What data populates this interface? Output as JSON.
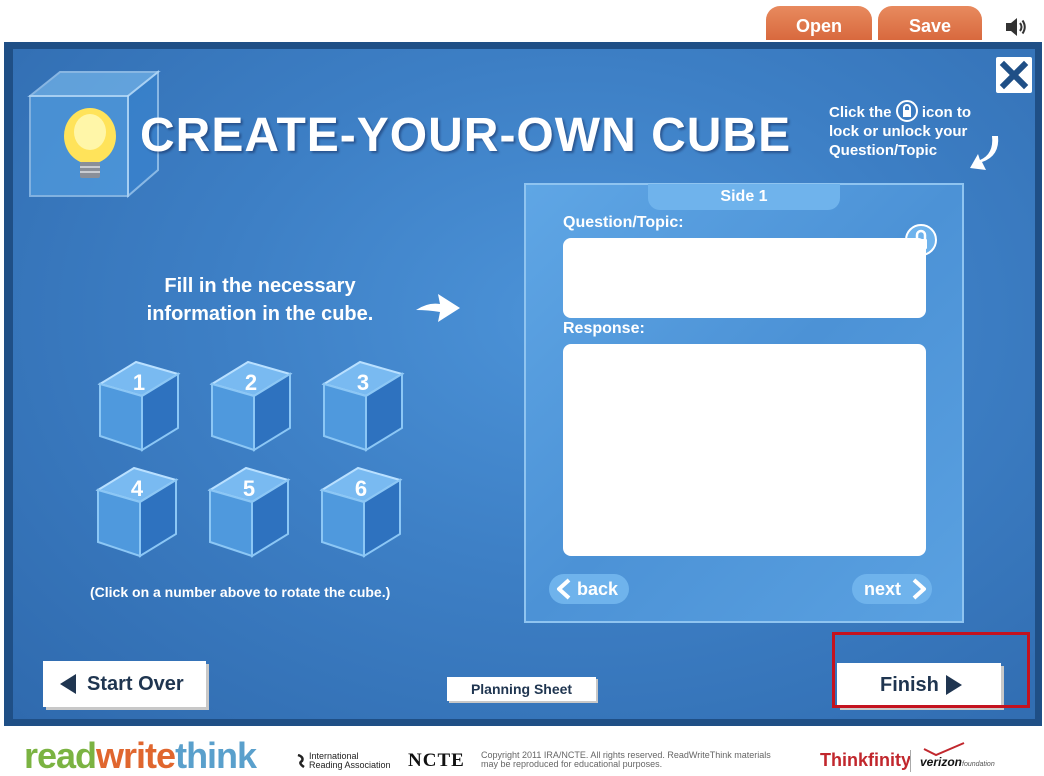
{
  "header": {
    "open_label": "Open",
    "save_label": "Save",
    "speaker_icon": "speaker-icon"
  },
  "main": {
    "title": "CREATE-YOUR-OWN CUBE",
    "lock_hint_before": "Click the",
    "lock_hint_after": "icon to lock or unlock your Question/Topic",
    "instructions": "Fill in the necessary information in the cube.",
    "cube_numbers": [
      "1",
      "2",
      "3",
      "4",
      "5",
      "6"
    ],
    "rotate_hint": "(Click on a number above to rotate the cube.)"
  },
  "editor": {
    "side_label": "Side 1",
    "question_label": "Question/Topic:",
    "question_value": "",
    "response_label": "Response:",
    "response_value": "",
    "back_label": "back",
    "next_label": "next"
  },
  "footer_buttons": {
    "start_over_label": "Start Over",
    "planning_sheet_label": "Planning Sheet",
    "finish_label": "Finish"
  },
  "footer": {
    "logo_read": "read",
    "logo_write": "write",
    "logo_think": "think",
    "ira_line1": "International",
    "ira_line2": "Reading Association",
    "ncte": "NCTE",
    "copyright": "Copyright 2011 IRA/NCTE. All rights reserved. ReadWriteThink materials may be reproduced for educational purposes.",
    "thinkfinity": "Thinkfinity",
    "verizon": "verizon",
    "verizon_sub": "foundation"
  },
  "colors": {
    "accent_tab": "#d8693e",
    "panel_blue": "#3d7fc5",
    "highlight_red": "#c4121f"
  }
}
